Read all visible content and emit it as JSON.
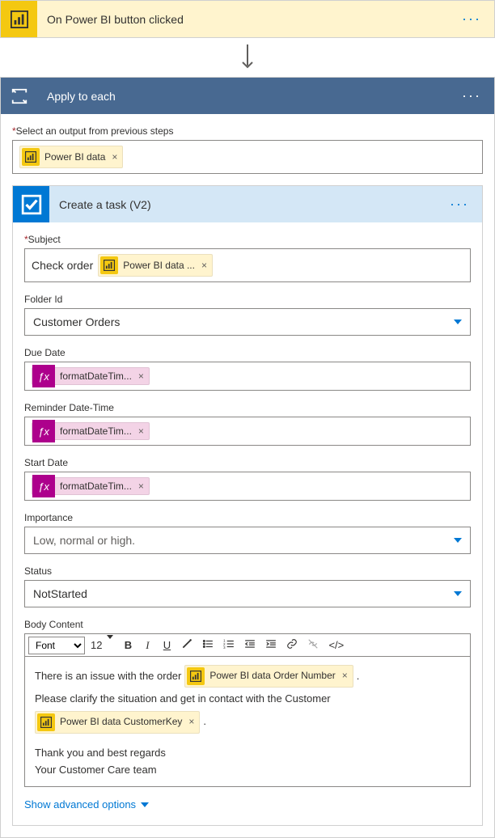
{
  "trigger": {
    "title": "On Power BI button clicked"
  },
  "apply": {
    "title": "Apply to each",
    "output_label_prefix": "*",
    "output_label": "Select an output from previous steps",
    "output_chip": "Power BI data"
  },
  "task": {
    "title": "Create a task (V2)",
    "labels": {
      "subject": "Subject",
      "folder": "Folder Id",
      "due": "Due Date",
      "reminder": "Reminder Date-Time",
      "start": "Start Date",
      "importance": "Importance",
      "status": "Status",
      "body": "Body Content"
    },
    "subject_prefix": "Check order",
    "subject_chip": "Power BI data ...",
    "folder_value": "Customer Orders",
    "fx_label": "formatDateTim...",
    "importance_placeholder": "Low, normal or high.",
    "status_value": "NotStarted",
    "rte": {
      "font": "Font",
      "size": "12",
      "body_line1_a": "There is an issue with the order",
      "body_chip1": "Power BI data Order Number",
      "body_line1_b": ".",
      "body_line2": "Please clarify the situation and get in contact with the Customer",
      "body_chip2": "Power BI data CustomerKey",
      "body_line2_b": ".",
      "body_line3": "Thank you and best regards",
      "body_line4": "Your Customer Care team"
    },
    "advanced": "Show advanced options"
  }
}
